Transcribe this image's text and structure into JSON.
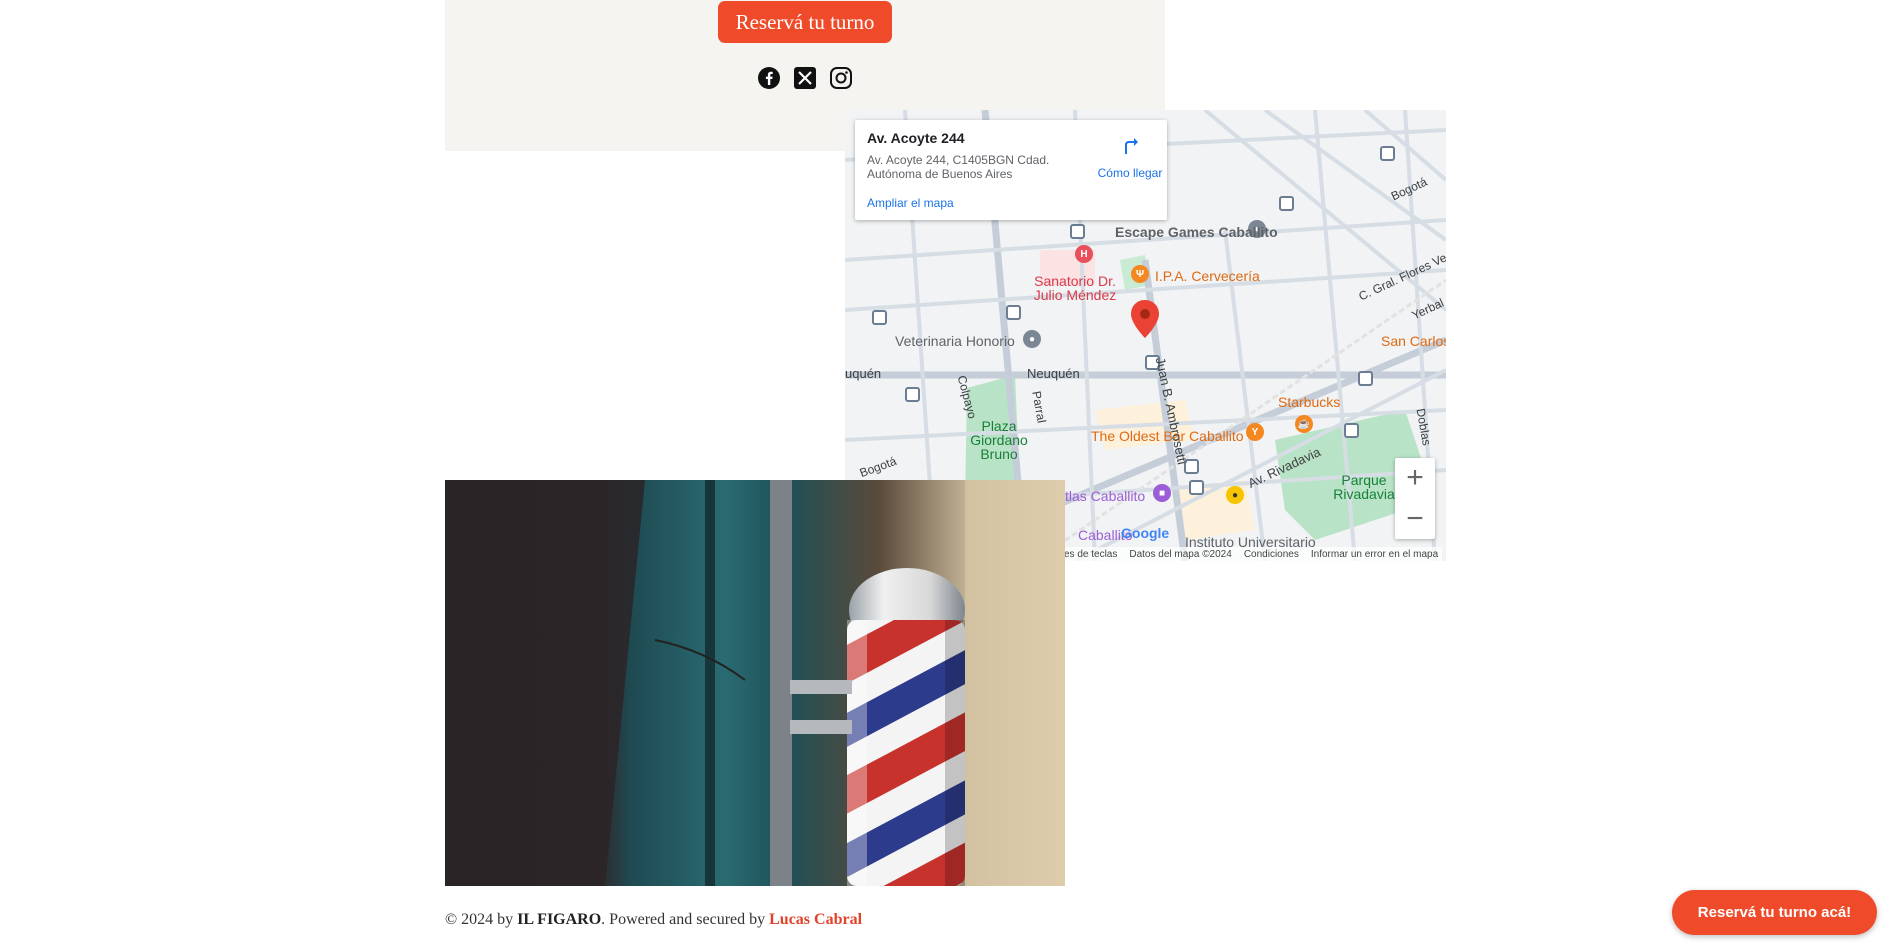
{
  "header": {
    "reserve_label": "Reservá tu turno"
  },
  "social": [
    "facebook-icon",
    "x-icon",
    "instagram-icon"
  ],
  "map": {
    "info": {
      "title": "Av. Acoyte 244",
      "address": "Av. Acoyte 244, C1405BGN Cdad. Autónoma de Buenos Aires",
      "directions": "Cómo llegar",
      "expand": "Ampliar el mapa"
    },
    "pois": {
      "escape": "Escape Games Caballito",
      "ipa": "I.P.A. Cervecería",
      "sanatorio": "Sanatorio Dr. Julio Méndez",
      "veterinaria": "Veterinaria Honorio",
      "starbucks": "Starbucks",
      "oldest": "The Oldest Bar Caballito",
      "plaza": "Plaza Giordano Bruno",
      "parque": "Parque Rivadavia",
      "atlas": "tlas Caballito",
      "caballito": "Caballito",
      "instituto": "Instituto Universitario",
      "san_carlos": "San Carlos"
    },
    "streets": {
      "neuquen": "Neuquén",
      "neuquen2": "uquén",
      "colpayo": "Colpayo",
      "parral": "Parral",
      "ambrosetti": "Juan B. Ambrosetti",
      "rivadavia": "Av. Rivadavia",
      "flores": "C. Gral. Flores Ve",
      "bogota1": "Bogotá",
      "bogota2": "Bogotá",
      "doblas": "Doblas",
      "yerbal": "Yerbal"
    },
    "google": "Google",
    "attribution": {
      "shortcuts": "es de teclas",
      "data": "Datos del mapa ©2024",
      "terms": "Condiciones",
      "report": "Informar un error en el mapa"
    }
  },
  "footer": {
    "prefix": "© 2024 by ",
    "brand": "IL FIGARO",
    "middle": ". Powered and secured by ",
    "author": "Lucas Cabral"
  },
  "cta": {
    "label": "Reservá tu turno acá!"
  },
  "colors": {
    "accent": "#ef4b2b",
    "panel": "#f5f4f0"
  }
}
